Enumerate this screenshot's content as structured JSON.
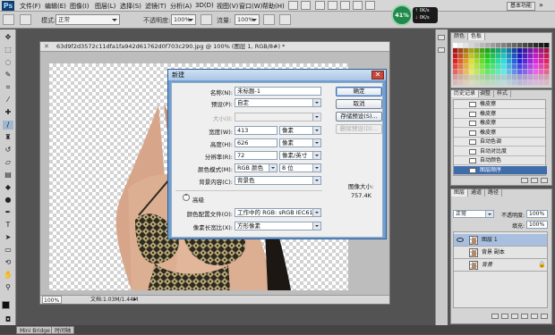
{
  "app": {
    "logo": "Ps"
  },
  "menu": [
    "文件(F)",
    "编辑(E)",
    "图像(I)",
    "图层(L)",
    "选择(S)",
    "滤镜(T)",
    "分析(A)",
    "3D(D)",
    "视图(V)",
    "窗口(W)",
    "帮助(H)"
  ],
  "workspace": "基本功能",
  "net_widget": {
    "percent": "41%",
    "up": "0K/s",
    "down": "0K/s"
  },
  "options": {
    "mode_label": "模式:",
    "mode_value": "正常",
    "opacity_label": "不透明度:",
    "opacity_value": "100%",
    "flow_label": "流量:",
    "flow_value": "100%"
  },
  "document": {
    "title": "63d9f2d3572c11dfa1fa942d61762d0f703c290.jpg @ 100% (图层 1, RGB/8#) *",
    "zoom": "100%",
    "status": "文档:1.03M/1.44M"
  },
  "dialog": {
    "title": "新建",
    "name_label": "名称(N):",
    "name_value": "未标题-1",
    "preset_label": "预设(P):",
    "preset_value": "自定",
    "size_label": "大小(I):",
    "width_label": "宽度(W):",
    "width_value": "413",
    "width_unit": "像素",
    "height_label": "高度(H):",
    "height_value": "626",
    "height_unit": "像素",
    "resolution_label": "分辨率(R):",
    "resolution_value": "72",
    "resolution_unit": "像素/英寸",
    "colormode_label": "颜色模式(M):",
    "colormode_value": "RGB 颜色",
    "colormode_bits": "8 位",
    "bg_label": "背景内容(C):",
    "bg_value": "背景色",
    "advanced_label": "高级",
    "profile_label": "颜色配置文件(O):",
    "profile_value": "工作中的 RGB: sRGB IEC6196...",
    "pixel_aspect_label": "像素长宽比(X):",
    "pixel_aspect_value": "方形像素",
    "ok": "确定",
    "cancel": "取消",
    "save_preset": "存储预设(S)...",
    "delete_preset": "删除预设(D)...",
    "image_size_label": "图像大小:",
    "image_size_value": "757.4K"
  },
  "panels": {
    "color_tabs": [
      "颜色",
      "色板"
    ],
    "history_tabs": [
      "历史记录",
      "调整",
      "样式"
    ],
    "history_items": [
      "橡皮擦",
      "橡皮擦",
      "橡皮擦",
      "橡皮擦",
      "自动色调",
      "自动对比度",
      "自动颜色",
      "图层顺序"
    ],
    "layers_tabs": [
      "图层",
      "通道",
      "路径"
    ],
    "blend_mode": "正常",
    "layer_opacity_label": "不透明度:",
    "layer_opacity": "100%",
    "fill_label": "填充:",
    "fill": "100%",
    "layers": [
      "图层 1",
      "背景 副本",
      "背景"
    ]
  },
  "bottom_tabs": [
    "Mini Bridge",
    "时间轴"
  ],
  "colors": {
    "selection": "#3f6cab",
    "dialog_frame": "#6f9fd0",
    "close_red": "#c8473c"
  }
}
